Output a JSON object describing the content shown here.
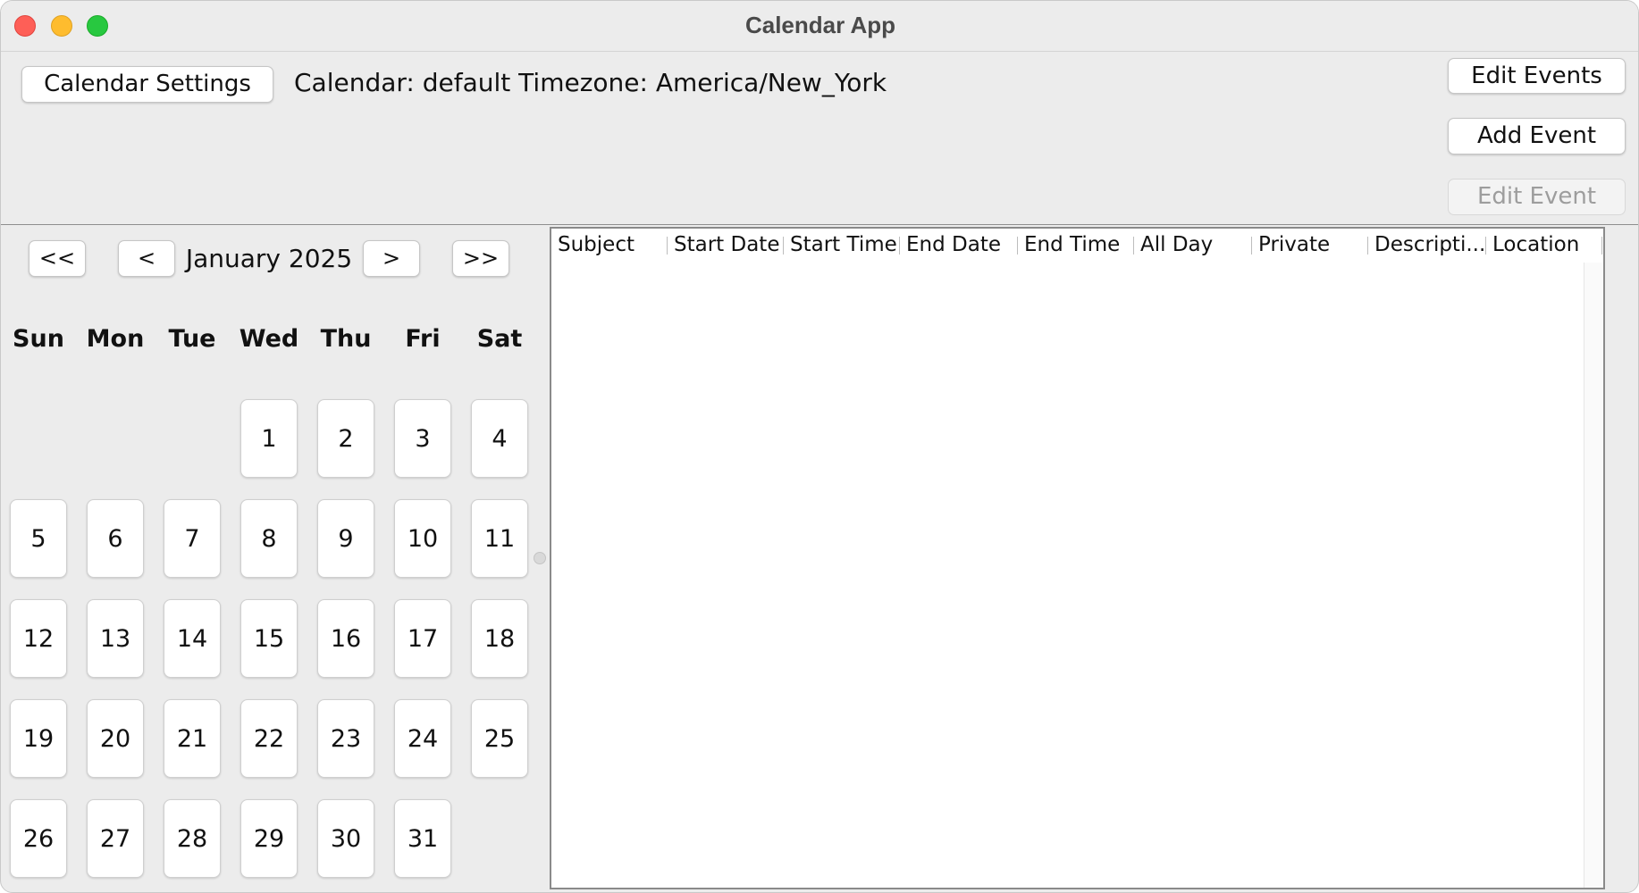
{
  "window": {
    "title": "Calendar App"
  },
  "toolbar": {
    "calendar_settings_label": "Calendar Settings",
    "info_text": "Calendar: default Timezone: America/New_York",
    "edit_events_label": "Edit Events",
    "add_event_label": "Add Event",
    "edit_event_label": "Edit Event"
  },
  "calendar": {
    "nav": {
      "prev_year": "<<",
      "prev_month": "<",
      "next_month": ">",
      "next_year": ">>"
    },
    "month_label": "January 2025",
    "weekdays": [
      "Sun",
      "Mon",
      "Tue",
      "Wed",
      "Thu",
      "Fri",
      "Sat"
    ],
    "first_weekday_index": 3,
    "days": [
      "1",
      "2",
      "3",
      "4",
      "5",
      "6",
      "7",
      "8",
      "9",
      "10",
      "11",
      "12",
      "13",
      "14",
      "15",
      "16",
      "17",
      "18",
      "19",
      "20",
      "21",
      "22",
      "23",
      "24",
      "25",
      "26",
      "27",
      "28",
      "29",
      "30",
      "31"
    ]
  },
  "events_table": {
    "columns": [
      "Subject",
      "Start Date",
      "Start Time",
      "End Date",
      "End Time",
      "All Day",
      "Private",
      "Descripti...",
      "Location"
    ],
    "rows": []
  },
  "colors": {
    "window_bg": "#ececec",
    "close": "#fe5f57",
    "minimize": "#febc2e",
    "maximize": "#28c840",
    "disabled_text": "#9d9d9d"
  }
}
